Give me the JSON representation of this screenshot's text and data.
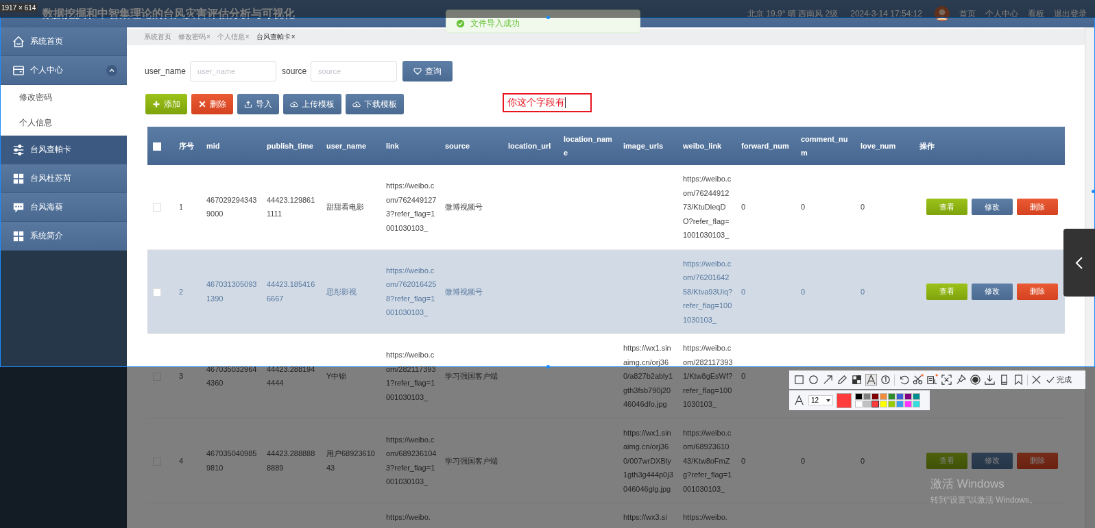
{
  "capture": {
    "size_label": "1917 × 614"
  },
  "header": {
    "title": "数据挖掘和中智集理论的台风灾害评估分析与可视化",
    "weather": "北京 19.9° 晴 西南风 2级",
    "datetime": "2024-3-14 17:54:12",
    "nav": [
      "首页",
      "个人中心",
      "看板",
      "退出登录"
    ]
  },
  "toast": {
    "text": "文件导入成功"
  },
  "sidebar": {
    "items": [
      {
        "label": "系统首页",
        "selected": false
      },
      {
        "label": "个人中心",
        "selected": false,
        "expanded": true,
        "children": [
          {
            "label": "修改密码",
            "selected": false
          },
          {
            "label": "个人信息",
            "selected": false
          }
        ]
      },
      {
        "label": "台风查帕卡",
        "selected": true
      },
      {
        "label": "台风杜苏芮",
        "selected": false
      },
      {
        "label": "台风海葵",
        "selected": false
      },
      {
        "label": "系统简介",
        "selected": false
      }
    ]
  },
  "tabs": [
    {
      "label": "系统首页",
      "selected": false
    },
    {
      "label": "修改密码",
      "close": "×",
      "selected": false
    },
    {
      "label": "个人信息",
      "close": "×",
      "selected": false
    },
    {
      "label": "台风查帕卡",
      "close": "×",
      "selected": true
    }
  ],
  "search": {
    "fields": [
      {
        "label": "user_name",
        "placeholder": "user_name"
      },
      {
        "label": "source",
        "placeholder": "source"
      }
    ],
    "button": "查询"
  },
  "actions": [
    {
      "label": "添加",
      "kind": "add"
    },
    {
      "label": "删除",
      "kind": "delete"
    },
    {
      "label": "导入",
      "kind": "import"
    },
    {
      "label": "上传模板",
      "kind": "upload"
    },
    {
      "label": "下载模板",
      "kind": "download"
    }
  ],
  "annotation": {
    "text": "你这个字段有"
  },
  "table": {
    "select_all": {
      "checked": false
    },
    "columns": [
      "序号",
      "mid",
      "publish_time",
      "user_name",
      "link",
      "source",
      "location_url",
      "location_name",
      "image_urls",
      "weibo_link",
      "forward_num",
      "comment_num",
      "love_num",
      "操作"
    ],
    "rows": [
      {
        "checked": false,
        "hovered": false,
        "cells": [
          "1",
          "4670292943439000",
          "44423.1298611111",
          "甜甜看电影",
          "https://weibo.com/7624491273?refer_flag=1001030103_",
          "微博视频号",
          null,
          null,
          null,
          "https://weibo.com/7624491273/KtuDleqDO?refer_flag=1001030103_",
          "0",
          "0",
          "0"
        ],
        "actions": [
          {
            "label": "查看",
            "kind": "view"
          },
          {
            "label": "修改",
            "kind": "edit"
          },
          {
            "label": "删除",
            "kind": "delete"
          }
        ]
      },
      {
        "checked": false,
        "hovered": true,
        "cells": [
          "2",
          "4670313050931390",
          "44423.1854166667",
          "思彤影视",
          "https://weibo.com/7620164258?refer_flag=1001030103_",
          "微博视频号",
          null,
          null,
          null,
          "https://weibo.com/7620164258/Ktva93Uiq?refer_flag=1001030103_",
          "0",
          "0",
          "0"
        ],
        "actions": [
          {
            "label": "查看",
            "kind": "view"
          },
          {
            "label": "修改",
            "kind": "edit"
          },
          {
            "label": "删除",
            "kind": "delete"
          }
        ]
      },
      {
        "checked": false,
        "hovered": false,
        "cells": [
          "3",
          "4670350329644360",
          "44423.2881944444",
          "Y中锦",
          "https://weibo.com/2821173931?refer_flag=1001030103_",
          "学习强国客户端",
          null,
          null,
          "https://wx1.sinaimg.cn/orj360/a827b2ably1gth3fsb790j2046046dfo.jpg",
          "https://weibo.com/2821173931/Ktw8gEsWf?refer_flag=1001030103_",
          "0",
          null,
          null
        ]
      },
      {
        "checked": false,
        "hovered": false,
        "cells": [
          "4",
          "4670350409859810",
          "44423.2888888889",
          "用户6892361043",
          "https://weibo.com/6892361043?refer_flag=1001030103_",
          "学习强国客户端",
          null,
          null,
          "https://wx1.sinaimg.cn/orj360/007wrDXBly1gth3g444p0j3046046glg.jpg",
          "https://weibo.com/6892361043/Ktw8oFmZg?refer_flag=1001030103_",
          "0",
          "0",
          "0"
        ],
        "actions": [
          {
            "label": "查看",
            "kind": "view"
          },
          {
            "label": "修改",
            "kind": "edit"
          },
          {
            "label": "删除",
            "kind": "delete"
          }
        ]
      },
      {
        "hovered": false,
        "cells": [
          null,
          null,
          null,
          null,
          "https://weibo.",
          null,
          null,
          null,
          "https://wx3.si",
          "https://weibo.",
          null,
          null,
          null
        ]
      }
    ]
  },
  "screenshot_toolbar": {
    "tools": [
      {
        "kind": "rect",
        "selected": false
      },
      {
        "kind": "ellipse",
        "selected": false
      },
      {
        "kind": "arrow",
        "selected": false
      },
      {
        "kind": "pencil",
        "selected": false
      },
      {
        "kind": "mosaic",
        "selected": false
      },
      {
        "kind": "text",
        "selected": true
      },
      {
        "kind": "number",
        "selected": false
      },
      {
        "kind": "sep"
      },
      {
        "kind": "undo",
        "selected": false
      },
      {
        "kind": "scissors",
        "selected": false
      },
      {
        "kind": "ocr",
        "selected": false
      },
      {
        "kind": "scan",
        "selected": false
      },
      {
        "kind": "pin",
        "selected": false
      },
      {
        "kind": "record",
        "selected": false
      },
      {
        "kind": "save",
        "selected": false
      },
      {
        "kind": "phone",
        "selected": false
      },
      {
        "kind": "bookmark",
        "selected": false
      },
      {
        "kind": "sep"
      },
      {
        "kind": "close",
        "selected": false
      }
    ],
    "done": "完成",
    "font_size": "12",
    "colors": [
      {
        "color": "#000000",
        "selected": false
      },
      {
        "color": "#808080",
        "selected": false
      },
      {
        "color": "#800000",
        "selected": false
      },
      {
        "color": "#f08c3c",
        "selected": false
      },
      {
        "color": "#2e8b2e",
        "selected": false
      },
      {
        "color": "#3a5fd8",
        "selected": false
      },
      {
        "color": "#800080",
        "selected": false
      },
      {
        "color": "#009090",
        "selected": false
      },
      {
        "color": "#ffffff",
        "selected": false
      },
      {
        "color": "#c0c0c0",
        "selected": false
      },
      {
        "color": "#ff3b3b",
        "selected": true
      },
      {
        "color": "#ffff00",
        "selected": false
      },
      {
        "color": "#99cc00",
        "selected": false
      },
      {
        "color": "#3a9bea",
        "selected": false
      },
      {
        "color": "#ff33ff",
        "selected": false
      },
      {
        "color": "#33dddd",
        "selected": false
      }
    ]
  },
  "os_notice": {
    "title": "激活 Windows",
    "subtitle": "转到“设置”以激活 Windows。"
  }
}
